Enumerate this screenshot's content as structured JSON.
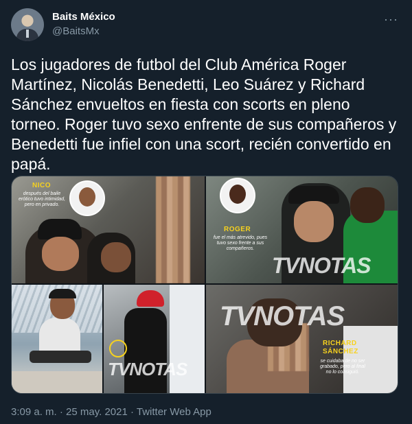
{
  "tweet": {
    "author_name": "Baits México",
    "author_handle": "@BaitsMx",
    "more_icon": "···",
    "text": "Los jugadores de futbol del Club América Roger Martínez, Nicolás Benedetti, Leo Suárez y Richard Sánchez envueltos en fiesta con scorts en pleno torneo. Roger tuvo sexo enfrente de sus compañeros y Benedetti fue infiel con una scort, recién convertido en papá.",
    "meta": "3:09 a. m. · 25 may. 2021 · Twitter Web App"
  },
  "media": {
    "panel1": {
      "title": "NICO",
      "caption": "después del baile erótico tuvo intimidad, pero en privado."
    },
    "panel2": {
      "title": "ROGER",
      "caption": "fue el más atrevido, pues tuvo sexo frente a sus compañeros.",
      "watermark": "TVNOTAS"
    },
    "panel4": {
      "watermark": "TVNOTAS"
    },
    "panel5": {
      "watermark": "TVNOTAS",
      "title_line1": "RICHARD",
      "title_line2": "SÁNCHEZ",
      "caption": "se cuidaba de no ser grabado, pero al final no lo consiguió."
    }
  },
  "colors": {
    "background": "#15202b",
    "secondary_text": "#8899a6",
    "caption_yellow": "#f7d21e"
  }
}
